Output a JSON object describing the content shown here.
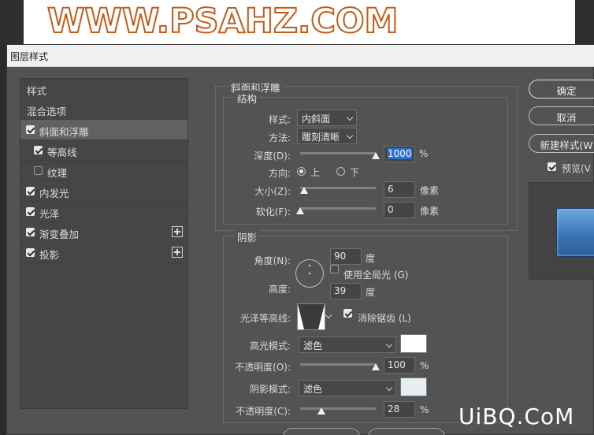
{
  "banner": {
    "text": "WWW.PSAHZ.COM"
  },
  "dialog": {
    "title": "图层样式"
  },
  "left_list": [
    {
      "label": "样式",
      "checkbox": null
    },
    {
      "label": "混合选项",
      "checkbox": null
    },
    {
      "label": "斜面和浮雕",
      "checkbox": true,
      "selected": true
    },
    {
      "label": "等高线",
      "checkbox": true
    },
    {
      "label": "纹理",
      "checkbox": false
    },
    {
      "label": "内发光",
      "checkbox": true
    },
    {
      "label": "光泽",
      "checkbox": true
    },
    {
      "label": "渐变叠加",
      "checkbox": true,
      "plus": true
    },
    {
      "label": "投影",
      "checkbox": true,
      "plus": true
    }
  ],
  "bevel": {
    "section_title": "斜面和浮雕",
    "structure_title": "结构",
    "style_label": "样式:",
    "style_value": "内斜面",
    "technique_label": "方法:",
    "technique_value": "雕刻清晰",
    "depth_label": "深度(D):",
    "depth_value": "1000",
    "depth_unit": "%",
    "direction_label": "方向:",
    "direction_up": "上",
    "direction_down": "下",
    "size_label": "大小(Z):",
    "size_value": "6",
    "size_unit": "像素",
    "soften_label": "软化(F):",
    "soften_value": "0",
    "soften_unit": "像素"
  },
  "shading": {
    "title": "阴影",
    "angle_label": "角度(N):",
    "angle_value": "90",
    "angle_unit": "度",
    "global_light_label": "使用全局光 (G)",
    "altitude_label": "高度:",
    "altitude_value": "39",
    "altitude_unit": "度",
    "gloss_label": "光泽等高线:",
    "antialias_label": "消除锯齿 (L)",
    "highlight_mode_label": "高光模式:",
    "highlight_mode_value": "滤色",
    "highlight_opacity_label": "不透明度(O):",
    "highlight_opacity_value": "100",
    "highlight_opacity_unit": "%",
    "shadow_mode_label": "阴影模式:",
    "shadow_mode_value": "滤色",
    "shadow_opacity_label": "不透明度(C):",
    "shadow_opacity_value": "28",
    "shadow_opacity_unit": "%"
  },
  "right": {
    "ok_label": "确定",
    "cancel_label": "取消",
    "new_style_label": "新建样式(W",
    "preview_label": "预览(V"
  },
  "watermark": "UiBQ.CoM",
  "colors": {
    "banner_outline": "#c45a18",
    "dialog_bg": "#535353",
    "highlight_swatch": "#ffffff",
    "shadow_swatch": "#e6eef2",
    "preview_tile": "#3b74b8"
  }
}
